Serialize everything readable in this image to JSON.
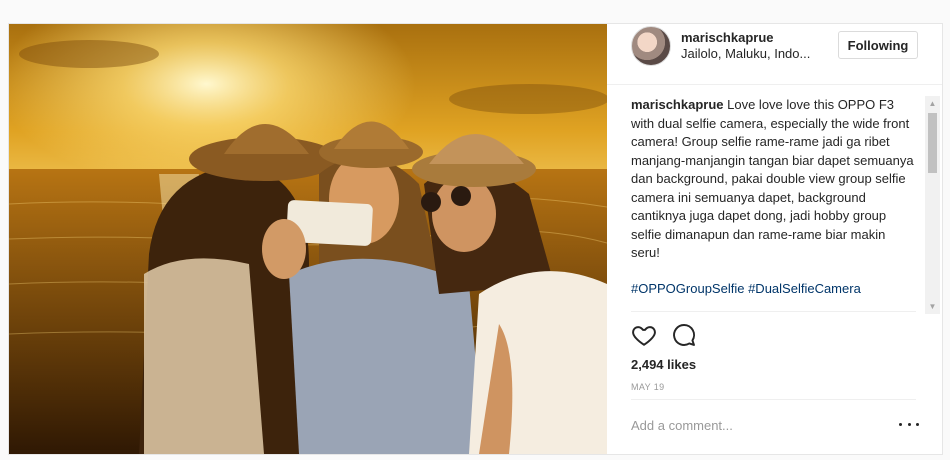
{
  "post": {
    "image_alt": "Three women in straw hats taking a selfie at sunset by the sea",
    "author": {
      "username": "marischkaprue",
      "location": "Jailolo, Maluku, Indo..."
    },
    "follow_button_label": "Following",
    "caption": {
      "username": "marischkaprue",
      "text": "Love love love this OPPO F3 with dual selfie camera, especially the wide front camera! Group selfie rame-rame jadi ga ribet manjang-manjangin tangan biar dapet semuanya dan background, pakai double view group selfie camera ini semuanya dapet, background cantiknya juga dapet dong, jadi hobby group selfie dimanapun dan rame-rame biar makin seru!",
      "hashtags": [
        "#OPPOGroupSelfie",
        "#DualSelfieCamera"
      ]
    },
    "likes_text": "2,494 likes",
    "date_text": "MAY 19",
    "comment_placeholder": "Add a comment...",
    "icons": {
      "like": "heart-icon",
      "comment": "speech-bubble-icon",
      "more": "ellipsis-icon"
    },
    "colors": {
      "link": "#003569",
      "text": "#262626",
      "muted": "#999999"
    }
  }
}
